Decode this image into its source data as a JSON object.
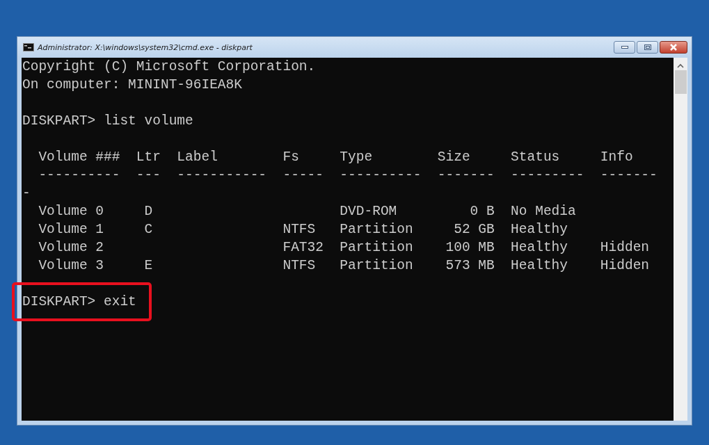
{
  "window": {
    "title": "Administrator: X:\\windows\\system32\\cmd.exe - diskpart"
  },
  "console": {
    "blocks": [
      {
        "lines": [
          "Copyright (C) Microsoft Corporation.",
          "On computer: MININT-96IEA8K"
        ],
        "highlighted": false
      },
      {
        "lines": [
          "DISKPART> list volume"
        ],
        "highlighted": false
      },
      {
        "lines": [
          "  Volume ###  Ltr  Label        Fs     Type        Size     Status     Info",
          "  ----------  ---  -----------  -----  ----------  -------  ---------  -------",
          "-",
          "  Volume 0     D                       DVD-ROM         0 B  No Media",
          "  Volume 1     C                NTFS   Partition     52 GB  Healthy",
          "  Volume 2                      FAT32  Partition    100 MB  Healthy    Hidden",
          "  Volume 3     E                NTFS   Partition    573 MB  Healthy    Hidden"
        ],
        "highlighted": false
      },
      {
        "lines": [
          "DISKPART> exit"
        ],
        "highlighted": true
      }
    ]
  }
}
